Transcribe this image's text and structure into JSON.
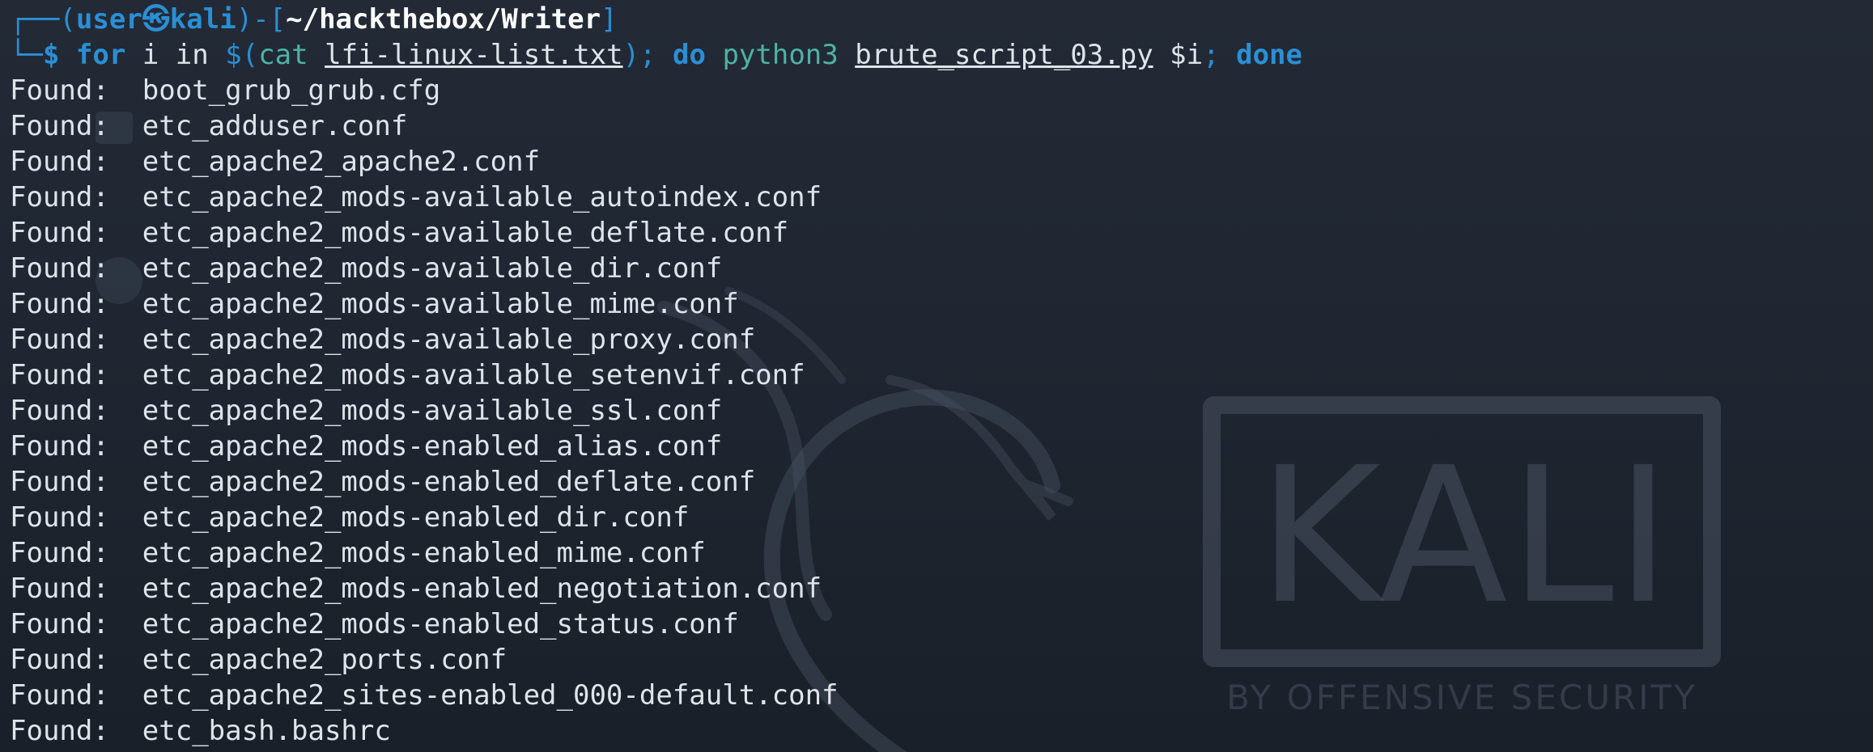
{
  "prompt": {
    "corner_top": "┌──",
    "open_paren": "(",
    "user": "user",
    "at_symbol": "㉿",
    "host": "kali",
    "close_paren": ")",
    "dash": "-",
    "open_bracket": "[",
    "cwd": "~/hackthebox/Writer",
    "close_bracket": "]",
    "corner_bottom": "└─",
    "symbol": "$"
  },
  "command": {
    "for_kw": "for",
    "loop_var": "i",
    "in_kw": "in",
    "subshell_open": "$(",
    "cat_cmd": "cat",
    "wordlist": "lfi-linux-list.txt",
    "subshell_close": ");",
    "do_kw": "do",
    "interpreter": "python3",
    "script": "brute_script_03.py",
    "arg": "$i",
    "semicolon": ";",
    "done_kw": "done"
  },
  "output": {
    "label": "Found:",
    "files": [
      "boot_grub_grub.cfg",
      "etc_adduser.conf",
      "etc_apache2_apache2.conf",
      "etc_apache2_mods-available_autoindex.conf",
      "etc_apache2_mods-available_deflate.conf",
      "etc_apache2_mods-available_dir.conf",
      "etc_apache2_mods-available_mime.conf",
      "etc_apache2_mods-available_proxy.conf",
      "etc_apache2_mods-available_setenvif.conf",
      "etc_apache2_mods-available_ssl.conf",
      "etc_apache2_mods-enabled_alias.conf",
      "etc_apache2_mods-enabled_deflate.conf",
      "etc_apache2_mods-enabled_dir.conf",
      "etc_apache2_mods-enabled_mime.conf",
      "etc_apache2_mods-enabled_negotiation.conf",
      "etc_apache2_mods-enabled_status.conf",
      "etc_apache2_ports.conf",
      "etc_apache2_sites-enabled_000-default.conf",
      "etc_bash.bashrc"
    ]
  },
  "wallpaper": {
    "logo_text": "KALI",
    "tagline": "BY OFFENSIVE SECURITY"
  },
  "colors": {
    "background": "#1f2631",
    "prompt_blue": "#2a8fd4",
    "command_teal": "#4db2a5",
    "text": "#dfe3ea"
  }
}
